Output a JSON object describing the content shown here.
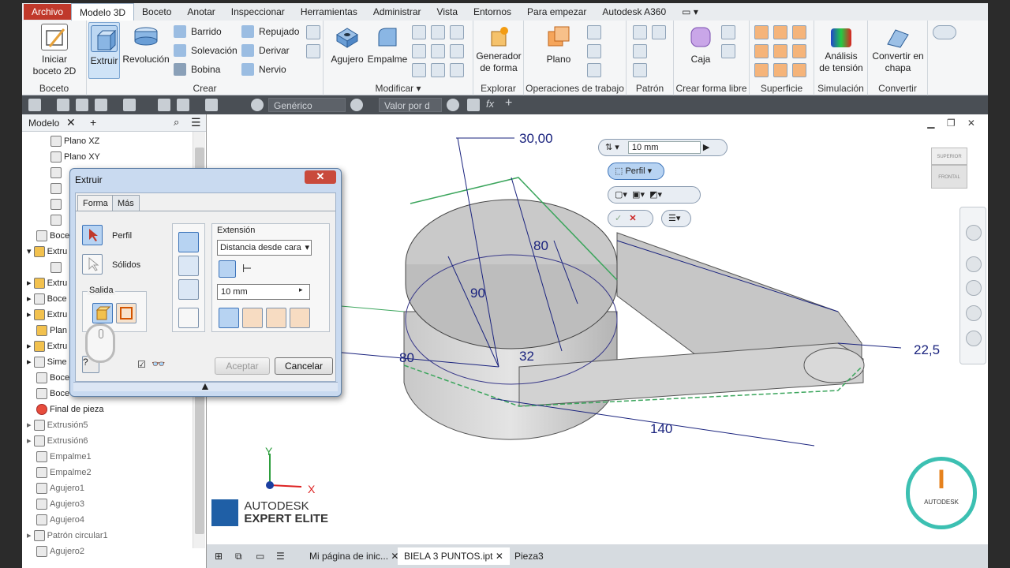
{
  "menu": {
    "file": "Archivo",
    "tabs": [
      "Modelo 3D",
      "Boceto",
      "Anotar",
      "Inspeccionar",
      "Herramientas",
      "Administrar",
      "Vista",
      "Entornos",
      "Para empezar",
      "Autodesk A360"
    ]
  },
  "ribbon": {
    "sketch": {
      "start_line1": "Iniciar",
      "start_line2": "boceto 2D",
      "title": "Boceto"
    },
    "create": {
      "extrude": "Extruir",
      "revolve": "Revolución",
      "sweep": "Barrido",
      "loft": "Solevación",
      "coil": "Bobina",
      "emboss": "Repujado",
      "derive": "Derivar",
      "rib": "Nervio",
      "title": "Crear"
    },
    "modify": {
      "hole": "Agujero",
      "fillet": "Empalme",
      "title": "Modificar"
    },
    "explore": {
      "shape_gen_line1": "Generador",
      "shape_gen_line2": "de forma",
      "title": "Explorar"
    },
    "workfeatures": {
      "plane": "Plano",
      "title": "Operaciones de trabajo"
    },
    "pattern": {
      "title": "Patrón"
    },
    "freeform": {
      "box": "Caja",
      "title": "Crear forma libre"
    },
    "surface": {
      "title": "Superficie"
    },
    "simulation": {
      "stress_line1": "Análisis",
      "stress_line2": "de tensión",
      "title": "Simulación"
    },
    "convert": {
      "sheet_line1": "Convertir en",
      "sheet_line2": "chapa",
      "title": "Convertir"
    }
  },
  "qat": {
    "material": "Genérico",
    "appearance": "Valor por d",
    "fx": "fx"
  },
  "browser": {
    "tab": "Modelo",
    "items": [
      {
        "label": "Plano XZ",
        "indent": 2
      },
      {
        "label": "Plano XY",
        "indent": 2
      },
      {
        "label": "Final de pieza",
        "indent": 1
      },
      {
        "label": "Extrusión5",
        "indent": 1
      },
      {
        "label": "Extrusión6",
        "indent": 1
      },
      {
        "label": "Empalme1",
        "indent": 1
      },
      {
        "label": "Empalme2",
        "indent": 1
      },
      {
        "label": "Agujero1",
        "indent": 1
      },
      {
        "label": "Agujero3",
        "indent": 1
      },
      {
        "label": "Agujero4",
        "indent": 1
      },
      {
        "label": "Patrón circular1",
        "indent": 1
      },
      {
        "label": "Agujero2",
        "indent": 1
      }
    ],
    "partial": [
      "Boce",
      "Extru",
      "Extru",
      "Boce",
      "Extru",
      "Plan",
      "Extru",
      "Sime",
      "Boce",
      "Boce"
    ]
  },
  "dialog": {
    "title": "Extruir",
    "tabs": [
      "Forma",
      "Más"
    ],
    "profile": "Perfil",
    "solids": "Sólidos",
    "output": "Salida",
    "extent": "Extensión",
    "extent_value": "Distancia desde cara",
    "distance": "10 mm",
    "ok": "Aceptar",
    "cancel": "Cancelar"
  },
  "minitoolbar": {
    "distance": "10 mm",
    "profile": "Perfil"
  },
  "dimensions": {
    "d1": "30,00",
    "d2": "80",
    "d3": "90",
    "d4": "80",
    "d5": "32",
    "d6": "140",
    "d7": "22,5"
  },
  "viewcube": {
    "top": "SUPERIOR",
    "front": "FRONTAL"
  },
  "axes": {
    "x": "X",
    "y": "Y"
  },
  "branding": {
    "line1": "AUTODESK",
    "line2": "EXPERT ELITE",
    "badge": "AUTODESK"
  },
  "doctabs": [
    "Mi página de inic...",
    "BIELA 3 PUNTOS.ipt",
    "Pieza3"
  ],
  "colors": {
    "accent": "#3b73b9",
    "file_tab": "#c0392b",
    "dimension": "#1a237e",
    "sketch_green": "#4caf50"
  }
}
